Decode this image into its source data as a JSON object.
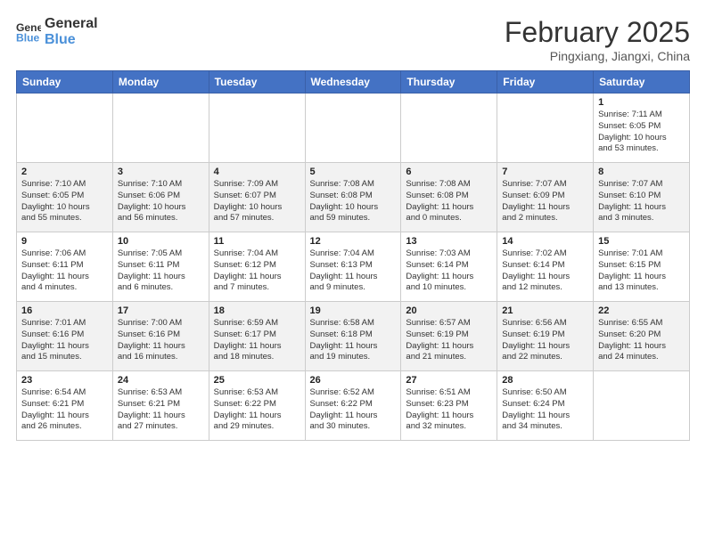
{
  "logo": {
    "line1": "General",
    "line2": "Blue"
  },
  "title": "February 2025",
  "location": "Pingxiang, Jiangxi, China",
  "weekdays": [
    "Sunday",
    "Monday",
    "Tuesday",
    "Wednesday",
    "Thursday",
    "Friday",
    "Saturday"
  ],
  "weeks": [
    [
      {
        "day": "",
        "info": ""
      },
      {
        "day": "",
        "info": ""
      },
      {
        "day": "",
        "info": ""
      },
      {
        "day": "",
        "info": ""
      },
      {
        "day": "",
        "info": ""
      },
      {
        "day": "",
        "info": ""
      },
      {
        "day": "1",
        "info": "Sunrise: 7:11 AM\nSunset: 6:05 PM\nDaylight: 10 hours\nand 53 minutes."
      }
    ],
    [
      {
        "day": "2",
        "info": "Sunrise: 7:10 AM\nSunset: 6:05 PM\nDaylight: 10 hours\nand 55 minutes."
      },
      {
        "day": "3",
        "info": "Sunrise: 7:10 AM\nSunset: 6:06 PM\nDaylight: 10 hours\nand 56 minutes."
      },
      {
        "day": "4",
        "info": "Sunrise: 7:09 AM\nSunset: 6:07 PM\nDaylight: 10 hours\nand 57 minutes."
      },
      {
        "day": "5",
        "info": "Sunrise: 7:08 AM\nSunset: 6:08 PM\nDaylight: 10 hours\nand 59 minutes."
      },
      {
        "day": "6",
        "info": "Sunrise: 7:08 AM\nSunset: 6:08 PM\nDaylight: 11 hours\nand 0 minutes."
      },
      {
        "day": "7",
        "info": "Sunrise: 7:07 AM\nSunset: 6:09 PM\nDaylight: 11 hours\nand 2 minutes."
      },
      {
        "day": "8",
        "info": "Sunrise: 7:07 AM\nSunset: 6:10 PM\nDaylight: 11 hours\nand 3 minutes."
      }
    ],
    [
      {
        "day": "9",
        "info": "Sunrise: 7:06 AM\nSunset: 6:11 PM\nDaylight: 11 hours\nand 4 minutes."
      },
      {
        "day": "10",
        "info": "Sunrise: 7:05 AM\nSunset: 6:11 PM\nDaylight: 11 hours\nand 6 minutes."
      },
      {
        "day": "11",
        "info": "Sunrise: 7:04 AM\nSunset: 6:12 PM\nDaylight: 11 hours\nand 7 minutes."
      },
      {
        "day": "12",
        "info": "Sunrise: 7:04 AM\nSunset: 6:13 PM\nDaylight: 11 hours\nand 9 minutes."
      },
      {
        "day": "13",
        "info": "Sunrise: 7:03 AM\nSunset: 6:14 PM\nDaylight: 11 hours\nand 10 minutes."
      },
      {
        "day": "14",
        "info": "Sunrise: 7:02 AM\nSunset: 6:14 PM\nDaylight: 11 hours\nand 12 minutes."
      },
      {
        "day": "15",
        "info": "Sunrise: 7:01 AM\nSunset: 6:15 PM\nDaylight: 11 hours\nand 13 minutes."
      }
    ],
    [
      {
        "day": "16",
        "info": "Sunrise: 7:01 AM\nSunset: 6:16 PM\nDaylight: 11 hours\nand 15 minutes."
      },
      {
        "day": "17",
        "info": "Sunrise: 7:00 AM\nSunset: 6:16 PM\nDaylight: 11 hours\nand 16 minutes."
      },
      {
        "day": "18",
        "info": "Sunrise: 6:59 AM\nSunset: 6:17 PM\nDaylight: 11 hours\nand 18 minutes."
      },
      {
        "day": "19",
        "info": "Sunrise: 6:58 AM\nSunset: 6:18 PM\nDaylight: 11 hours\nand 19 minutes."
      },
      {
        "day": "20",
        "info": "Sunrise: 6:57 AM\nSunset: 6:19 PM\nDaylight: 11 hours\nand 21 minutes."
      },
      {
        "day": "21",
        "info": "Sunrise: 6:56 AM\nSunset: 6:19 PM\nDaylight: 11 hours\nand 22 minutes."
      },
      {
        "day": "22",
        "info": "Sunrise: 6:55 AM\nSunset: 6:20 PM\nDaylight: 11 hours\nand 24 minutes."
      }
    ],
    [
      {
        "day": "23",
        "info": "Sunrise: 6:54 AM\nSunset: 6:21 PM\nDaylight: 11 hours\nand 26 minutes."
      },
      {
        "day": "24",
        "info": "Sunrise: 6:53 AM\nSunset: 6:21 PM\nDaylight: 11 hours\nand 27 minutes."
      },
      {
        "day": "25",
        "info": "Sunrise: 6:53 AM\nSunset: 6:22 PM\nDaylight: 11 hours\nand 29 minutes."
      },
      {
        "day": "26",
        "info": "Sunrise: 6:52 AM\nSunset: 6:22 PM\nDaylight: 11 hours\nand 30 minutes."
      },
      {
        "day": "27",
        "info": "Sunrise: 6:51 AM\nSunset: 6:23 PM\nDaylight: 11 hours\nand 32 minutes."
      },
      {
        "day": "28",
        "info": "Sunrise: 6:50 AM\nSunset: 6:24 PM\nDaylight: 11 hours\nand 34 minutes."
      },
      {
        "day": "",
        "info": ""
      }
    ]
  ]
}
